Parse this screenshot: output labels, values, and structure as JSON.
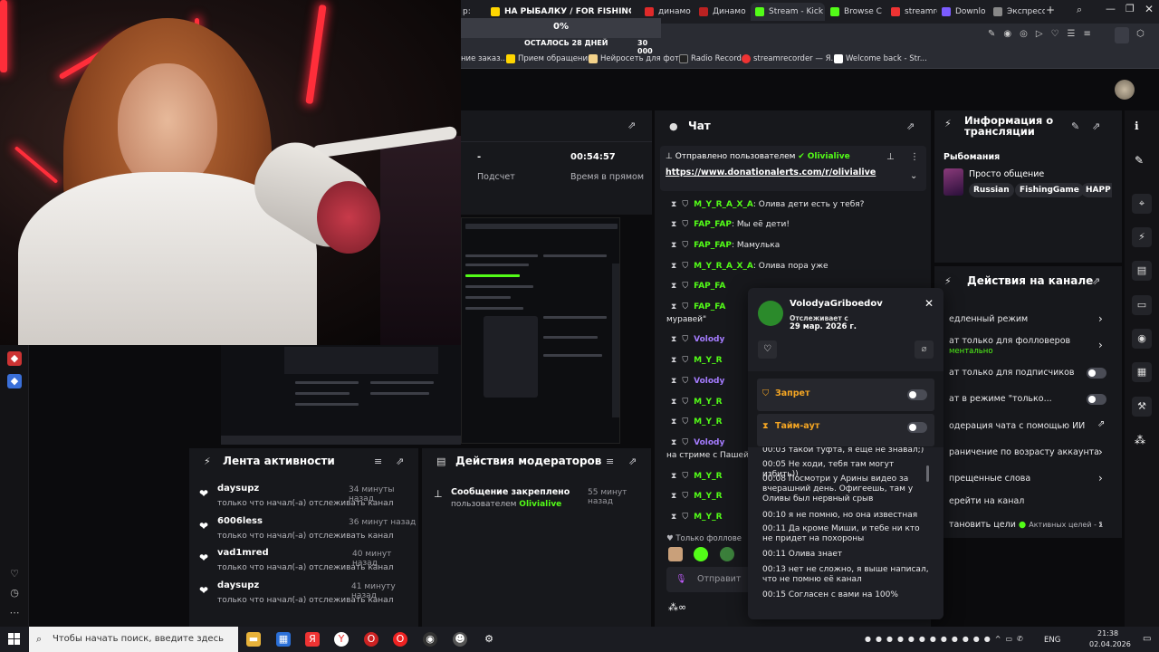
{
  "colors": {
    "kick_green": "#53fc18",
    "accent_red": "#ff2e3a",
    "panel_bg": "#17181c"
  },
  "browser": {
    "tabs": [
      {
        "label": "р:",
        "icon": "tab-icon"
      },
      {
        "label": "НА РЫБАЛКУ / FOR FISHING",
        "icon": "tab-icon"
      },
      {
        "label": "динамо",
        "icon": "tab-icon"
      },
      {
        "label": "Динамо",
        "icon": "tab-icon"
      },
      {
        "label": "Stream - Kick D",
        "icon": "kick-icon"
      },
      {
        "label": "Browse C",
        "icon": "tab-icon"
      },
      {
        "label": "streamre",
        "icon": "tab-icon"
      },
      {
        "label": "Downlo",
        "icon": "tab-icon"
      },
      {
        "label": "Экспресс",
        "icon": "grid-icon"
      }
    ],
    "bookmarks": [
      "ние заказ...",
      "Прием обращений",
      "Нейросеть для фот...",
      "Radio Record",
      "streamrecorder — Я...",
      "Welcome back - Str..."
    ]
  },
  "goal": {
    "percent": "0%",
    "remaining": "ОСТАЛОСЬ 28 ДНЕЙ",
    "amount": "30 000"
  },
  "stats": {
    "viewers_value": "-",
    "viewers_label": "Подсчет",
    "live_value": "00:54:57",
    "live_label": "Время в прямом"
  },
  "chat": {
    "title": "Чат",
    "pinned_by": "Отправлено пользователем",
    "pinned_user": "Olivialive",
    "pinned_link": "https://www.donationalerts.com/r/olivialive",
    "messages": [
      {
        "user": "M_Y_R_A_X_A",
        "text": ": Олива дети есть у тебя?"
      },
      {
        "user": "FAP_FAP",
        "text": ": Мы её дети!"
      },
      {
        "user": "FAP_FAP",
        "text": ": Мамулька"
      },
      {
        "user": "M_Y_R_A_X_A",
        "text": ": Олива пора уже"
      },
      {
        "user": "FAP_FA",
        "text": ""
      },
      {
        "user": "FAP_FA",
        "text": ""
      },
      {
        "user": "",
        "text": "муравей\""
      },
      {
        "user": "Volody",
        "text": ""
      },
      {
        "user": "M_Y_R",
        "text": ""
      },
      {
        "user": "Volody",
        "text": ""
      },
      {
        "user": "M_Y_R",
        "text": ""
      },
      {
        "user": "M_Y_R",
        "text": ""
      },
      {
        "user": "Volody",
        "text": ""
      },
      {
        "user": "",
        "text": "на стриме с Пашей"
      },
      {
        "user": "M_Y_R",
        "text": ""
      },
      {
        "user": "M_Y_R",
        "text": ""
      },
      {
        "user": "M_Y_R",
        "text": ""
      }
    ],
    "followers_only": "Только фоллове",
    "send_placeholder": "Отправит"
  },
  "usercard": {
    "username": "VolodyaGriboedov",
    "following_label": "Отслеживает с",
    "following_date": "29 мар. 2026 г.",
    "ban_label": "Запрет",
    "timeout_label": "Тайм-аут",
    "history": [
      "00:03 такой туфта, я еще не знавал;)",
      "00:05 Не ходи, тебя там могут избить))",
      "00:08 Посмотри у Арины видео за вчерашний день. Офигеешь, там у Оливы был нервный срыв",
      "00:10 я не помню, но она известная",
      "00:11 Да кроме Миши, и тебе ни кто не придет на похороны",
      "00:11 Олива знает",
      "00:13 нет не сложно, я выше написал, что не помню её канал",
      "00:15 Согласен с вами на 100%"
    ]
  },
  "stream_info": {
    "title": "Информация о трансляции",
    "category": "Рыбомания",
    "stream_title": "Просто общение",
    "tags": [
      "Russian",
      "FishingGame",
      "HAPP"
    ]
  },
  "channel_actions": {
    "title": "Действия на канале",
    "items": [
      "едленный режим",
      "ат только для фолловеров",
      "ат только для подписчиков",
      "ат в режиме \"только...",
      "одерация чата с помощью ИИ",
      "раничение по возрасту аккаунта",
      "прещенные слова",
      "ерейти на канал",
      "тановить цели"
    ],
    "followers_sub": "ментально",
    "goals_active": "Активных целей - 1"
  },
  "activity": {
    "title": "Лента активности",
    "items": [
      {
        "name": "daysupz",
        "sub": "только что начал(-а) отслеживать канал",
        "time": "34 минуты назад"
      },
      {
        "name": "6006less",
        "sub": "только что начал(-а) отслеживать канал",
        "time": "36 минут назад"
      },
      {
        "name": "vad1mred",
        "sub": "только что начал(-а) отслеживать канал",
        "time": "40 минут назад"
      },
      {
        "name": "daysupz",
        "sub": "только что начал(-а) отслеживать канал",
        "time": "41 минуту назад"
      }
    ]
  },
  "moderators": {
    "title": "Действия модераторов",
    "item_title": "Сообщение закреплено",
    "item_by": "пользователем",
    "item_user": "Olivialive",
    "item_time": "55 минут назад"
  },
  "taskbar": {
    "search_placeholder": "Чтобы начать поиск, введите здесь запрос",
    "lang": "ENG",
    "time": "21:38",
    "date": "02.04.2026"
  }
}
